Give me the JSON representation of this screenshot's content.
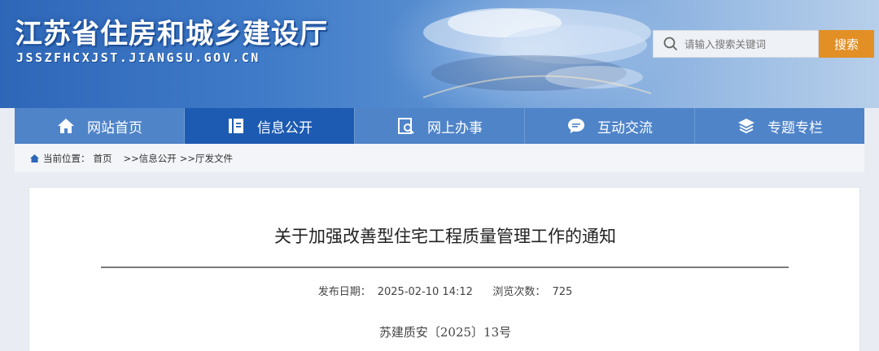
{
  "header": {
    "site_title": "江苏省住房和城乡建设厅",
    "site_domain": "JSSZFHCXJST.JIANGSU.GOV.CN",
    "search": {
      "placeholder": "请输入搜索关键词",
      "button_label": "搜索",
      "icon": "search-icon"
    }
  },
  "nav": {
    "items": [
      {
        "label": "网站首页",
        "icon": "home-icon",
        "active": false
      },
      {
        "label": "信息公开",
        "icon": "document-icon",
        "active": true
      },
      {
        "label": "网上办事",
        "icon": "online-service-icon",
        "active": false
      },
      {
        "label": "互动交流",
        "icon": "chat-bubble-icon",
        "active": false
      },
      {
        "label": "专题专栏",
        "icon": "layers-icon",
        "active": false
      }
    ]
  },
  "breadcrumb": {
    "prefix": "当前位置：",
    "items": [
      "首页",
      ">>信息公开",
      ">>厅发文件"
    ],
    "icon": "home-small-icon"
  },
  "article": {
    "title": "关于加强改善型住宅工程质量管理工作的通知",
    "publish_label": "发布日期：",
    "publish_date": "2025-02-10 14:12",
    "views_label": "浏览次数：",
    "views": "725",
    "doc_number": "苏建质安〔2025〕13号"
  },
  "colors": {
    "nav_bg": "#4f84c9",
    "nav_active": "#1d5bb2",
    "search_button": "#e28f25",
    "page_bg": "#e9edf3"
  }
}
